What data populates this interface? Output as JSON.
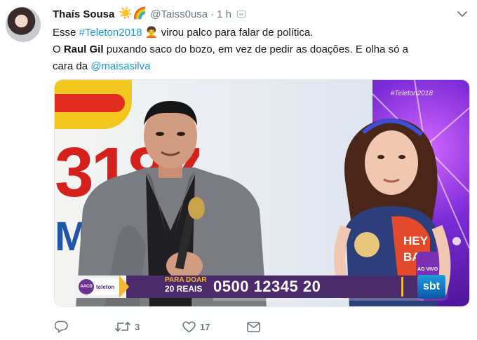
{
  "tweet": {
    "author_name": "Thaís Sousa",
    "author_handle": "@Taiss0usa",
    "separator": "·",
    "time": "1 h",
    "emoji": "☀️🌈",
    "text": {
      "l1_prefix": "Esse ",
      "hashtag": "#Teleton2018",
      "l1_suffix": " virou palco para falar de política.",
      "l2_prefix": "O ",
      "bold_name": "Raul Gil",
      "l2_rest": " puxando saco do bozo, em vez de pedir as doações. E olha só a",
      "l3_prefix": "cara da ",
      "mention": "@maisasilva"
    }
  },
  "media": {
    "hashtag_bug": "#Teleton2018",
    "background_letters": "3187",
    "background_letters_blue": "M",
    "aacd_circle": "AACD",
    "aacd_label": "teleton",
    "banner_para_doar": "PARA DOAR",
    "banner_amount": "20 REAIS",
    "banner_phone": "0500 12345 20",
    "ao_vivo": "AO VIVO",
    "channel_logo": "sbt",
    "shirt_text": "HEY BABY"
  },
  "actions": {
    "reply_count": "",
    "retweet_count": "3",
    "like_count": "17"
  },
  "icons": {
    "caret": "chevron-down-icon",
    "reply": "reply-icon",
    "retweet": "retweet-icon",
    "like": "heart-icon",
    "dm": "envelope-icon"
  },
  "colors": {
    "link": "#1b95e0",
    "muted": "#657786",
    "text": "#14171a"
  }
}
